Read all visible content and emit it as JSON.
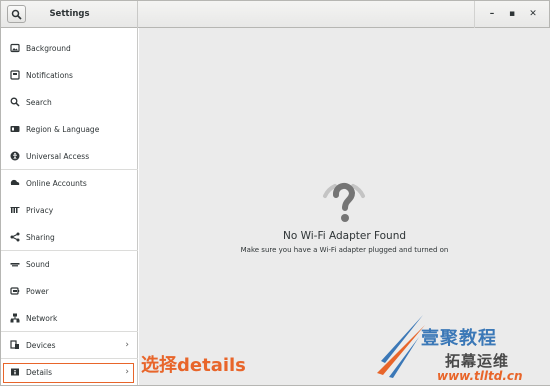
{
  "header": {
    "title": "Settings"
  },
  "window_controls": {
    "minimize": "–",
    "maximize": "▪",
    "close": "✕"
  },
  "sidebar": {
    "items": [
      {
        "label": "Background",
        "icon": "background-icon"
      },
      {
        "label": "Notifications",
        "icon": "notifications-icon"
      },
      {
        "label": "Search",
        "icon": "search-icon"
      },
      {
        "label": "Region & Language",
        "icon": "region-icon"
      },
      {
        "label": "Universal Access",
        "icon": "accessibility-icon"
      },
      {
        "label": "Online Accounts",
        "icon": "online-accounts-icon"
      },
      {
        "label": "Privacy",
        "icon": "privacy-icon"
      },
      {
        "label": "Sharing",
        "icon": "sharing-icon"
      },
      {
        "label": "Sound",
        "icon": "sound-icon"
      },
      {
        "label": "Power",
        "icon": "power-icon"
      },
      {
        "label": "Network",
        "icon": "network-icon"
      },
      {
        "label": "Devices",
        "icon": "devices-icon"
      },
      {
        "label": "Details",
        "icon": "details-icon"
      }
    ]
  },
  "main": {
    "title": "No Wi-Fi Adapter Found",
    "subtitle": "Make sure you have a Wi-Fi adapter plugged and turned on"
  },
  "annotation": {
    "text": "选择details",
    "color": "#e8652a"
  },
  "watermark": {
    "line1": "壹聚教程",
    "line2": "拓幕运维",
    "url": "www.tlltd.cn"
  },
  "colors": {
    "accent": "#e8652a",
    "main_bg": "#ebebeb",
    "watermark_blue": "#3b78b7"
  }
}
